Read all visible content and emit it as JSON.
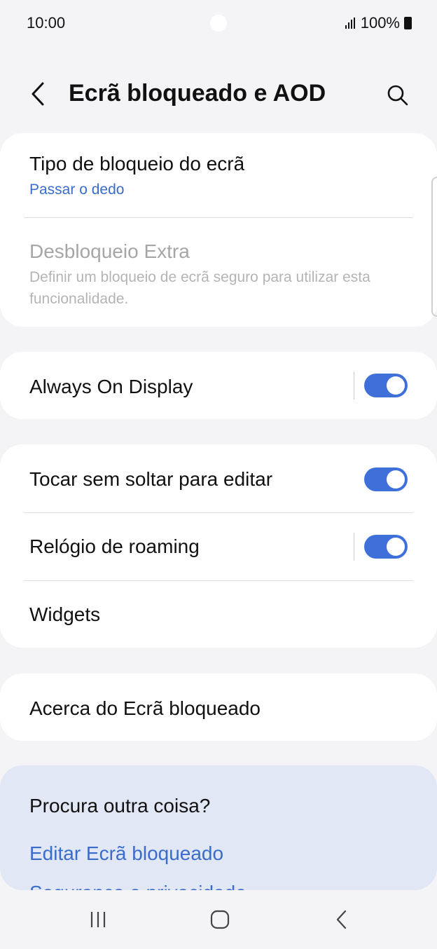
{
  "status_bar": {
    "time": "10:00",
    "battery_text": "100%",
    "signal_icon": "signal-icon",
    "battery_icon": "battery-icon"
  },
  "header": {
    "title": "Ecrã bloqueado e AOD",
    "back_icon": "chevron-left-icon",
    "search_icon": "search-icon"
  },
  "lock_section": {
    "lock_type": {
      "title": "Tipo de bloqueio do ecrã",
      "value": "Passar o dedo"
    },
    "extra_unlock": {
      "title": "Desbloqueio Extra",
      "subtitle_line1": "Definir um bloqueio de ecrã seguro para utilizar esta",
      "subtitle_line2": "funcionalidade.",
      "enabled": false
    }
  },
  "aod_section": {
    "always_on_display": {
      "label": "Always On Display",
      "on": true
    }
  },
  "options_section": {
    "touch_hold_edit": {
      "label": "Tocar sem soltar para editar",
      "on": true
    },
    "roaming_clock": {
      "label": "Relógio de roaming",
      "on": true
    },
    "widgets": {
      "label": "Widgets"
    }
  },
  "about_section": {
    "about": {
      "label": "Acerca do Ecrã bloqueado"
    }
  },
  "suggestions": {
    "title": "Procura outra coisa?",
    "link1": "Editar Ecrã bloqueado",
    "link2_partial": "Segurança e privacidade"
  },
  "navbar": {
    "recents_icon": "recents-icon",
    "home_icon": "home-icon",
    "back_icon": "back-icon"
  },
  "colors": {
    "accent": "#3f6fd8",
    "link": "#3a6ccb",
    "background": "#f4f4f6",
    "card": "#ffffff",
    "suggestion_bg": "#e1e7f4",
    "disabled_text": "#a6a6a6"
  }
}
